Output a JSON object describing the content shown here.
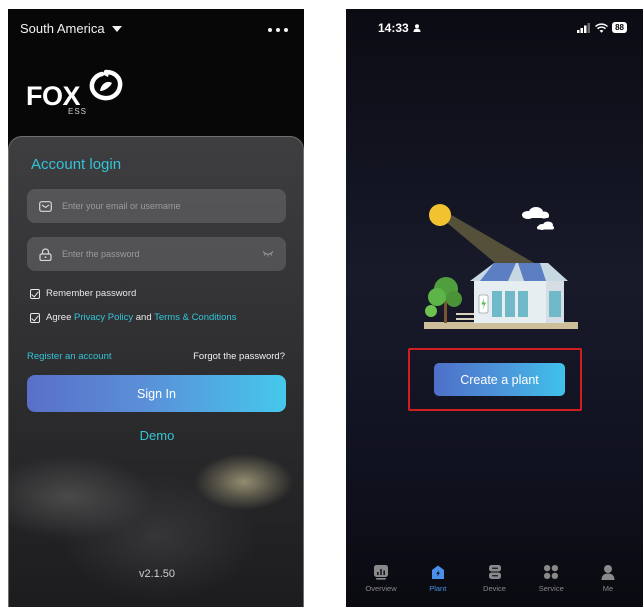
{
  "left_screen": {
    "region_label": "South America",
    "logo": {
      "brand": "FOX",
      "sub": "ESS"
    },
    "card_title": "Account login",
    "email_placeholder": "Enter your email or username",
    "password_placeholder": "Enter the password",
    "remember_label": "Remember password",
    "agree_prefix": "Agree",
    "privacy_link": "Privacy Policy",
    "and_text": "and",
    "terms_link": "Terms & Conditions",
    "register_link": "Register an account",
    "forgot_link": "Forgot the password?",
    "signin_label": "Sign In",
    "demo_label": "Demo",
    "version": "v2.1.50"
  },
  "right_screen": {
    "status_time": "14:33",
    "battery": "88",
    "create_button": "Create a plant",
    "tabs": [
      {
        "label": "Overview",
        "icon": "chart-icon",
        "active": false
      },
      {
        "label": "Plant",
        "icon": "plant-icon",
        "active": true
      },
      {
        "label": "Device",
        "icon": "device-icon",
        "active": false
      },
      {
        "label": "Service",
        "icon": "service-icon",
        "active": false
      },
      {
        "label": "Me",
        "icon": "person-icon",
        "active": false
      }
    ]
  },
  "colors": {
    "accent": "#33c3d6",
    "highlight": "#d11f1f",
    "tab_active": "#4b8fe8"
  }
}
